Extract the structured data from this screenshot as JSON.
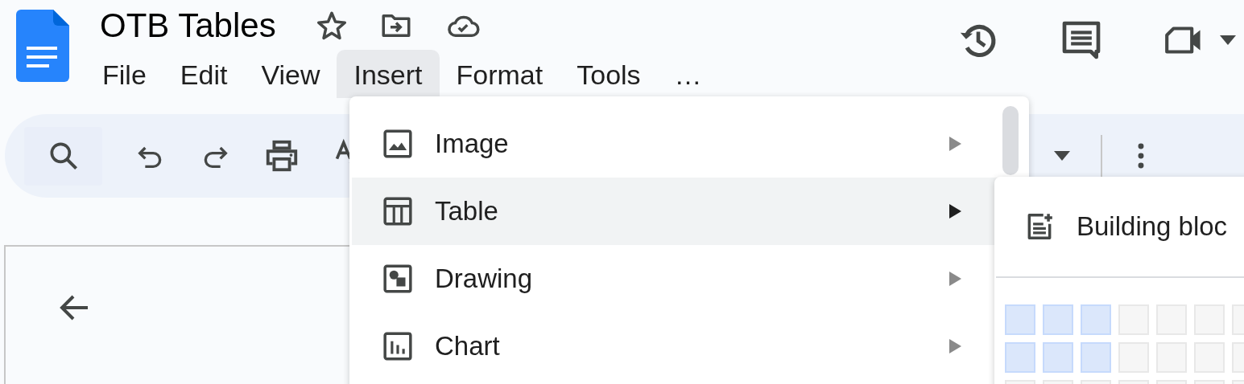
{
  "document": {
    "title": "OTB Tables"
  },
  "menu_bar": [
    {
      "label": "File",
      "selected": false
    },
    {
      "label": "Edit",
      "selected": false
    },
    {
      "label": "View",
      "selected": false
    },
    {
      "label": "Insert",
      "selected": true
    },
    {
      "label": "Format",
      "selected": false
    },
    {
      "label": "Tools",
      "selected": false
    },
    {
      "label": "…",
      "selected": false
    }
  ],
  "insert_menu": {
    "items": [
      {
        "kind": "image",
        "label": "Image",
        "selected": false
      },
      {
        "kind": "table",
        "label": "Table",
        "selected": true
      },
      {
        "kind": "drawing",
        "label": "Drawing",
        "selected": false
      },
      {
        "kind": "chart",
        "label": "Chart",
        "selected": false
      }
    ]
  },
  "table_submenu": {
    "items": [
      {
        "label": "Building bloc"
      }
    ],
    "grid": [
      [
        {
          "selected": true
        },
        {
          "selected": true
        },
        {
          "selected": true
        },
        {
          "selected": false
        },
        {
          "selected": false
        },
        {
          "selected": false
        },
        {
          "selected": false
        }
      ],
      [
        {
          "selected": true
        },
        {
          "selected": true
        },
        {
          "selected": true
        },
        {
          "selected": false
        },
        {
          "selected": false
        },
        {
          "selected": false
        },
        {
          "selected": false
        }
      ],
      [
        {
          "selected": false
        },
        {
          "selected": false
        },
        {
          "selected": false
        },
        {
          "selected": false
        },
        {
          "selected": false
        },
        {
          "selected": false
        },
        {
          "selected": false
        }
      ]
    ]
  }
}
